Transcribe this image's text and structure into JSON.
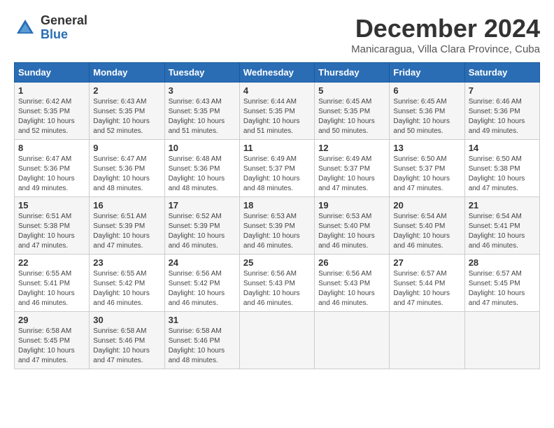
{
  "logo": {
    "general": "General",
    "blue": "Blue"
  },
  "title": {
    "month": "December 2024",
    "location": "Manicaragua, Villa Clara Province, Cuba"
  },
  "headers": [
    "Sunday",
    "Monday",
    "Tuesday",
    "Wednesday",
    "Thursday",
    "Friday",
    "Saturday"
  ],
  "weeks": [
    [
      {
        "day": "1",
        "sunrise": "6:42 AM",
        "sunset": "5:35 PM",
        "daylight": "10 hours and 52 minutes."
      },
      {
        "day": "2",
        "sunrise": "6:43 AM",
        "sunset": "5:35 PM",
        "daylight": "10 hours and 52 minutes."
      },
      {
        "day": "3",
        "sunrise": "6:43 AM",
        "sunset": "5:35 PM",
        "daylight": "10 hours and 51 minutes."
      },
      {
        "day": "4",
        "sunrise": "6:44 AM",
        "sunset": "5:35 PM",
        "daylight": "10 hours and 51 minutes."
      },
      {
        "day": "5",
        "sunrise": "6:45 AM",
        "sunset": "5:35 PM",
        "daylight": "10 hours and 50 minutes."
      },
      {
        "day": "6",
        "sunrise": "6:45 AM",
        "sunset": "5:36 PM",
        "daylight": "10 hours and 50 minutes."
      },
      {
        "day": "7",
        "sunrise": "6:46 AM",
        "sunset": "5:36 PM",
        "daylight": "10 hours and 49 minutes."
      }
    ],
    [
      {
        "day": "8",
        "sunrise": "6:47 AM",
        "sunset": "5:36 PM",
        "daylight": "10 hours and 49 minutes."
      },
      {
        "day": "9",
        "sunrise": "6:47 AM",
        "sunset": "5:36 PM",
        "daylight": "10 hours and 48 minutes."
      },
      {
        "day": "10",
        "sunrise": "6:48 AM",
        "sunset": "5:36 PM",
        "daylight": "10 hours and 48 minutes."
      },
      {
        "day": "11",
        "sunrise": "6:49 AM",
        "sunset": "5:37 PM",
        "daylight": "10 hours and 48 minutes."
      },
      {
        "day": "12",
        "sunrise": "6:49 AM",
        "sunset": "5:37 PM",
        "daylight": "10 hours and 47 minutes."
      },
      {
        "day": "13",
        "sunrise": "6:50 AM",
        "sunset": "5:37 PM",
        "daylight": "10 hours and 47 minutes."
      },
      {
        "day": "14",
        "sunrise": "6:50 AM",
        "sunset": "5:38 PM",
        "daylight": "10 hours and 47 minutes."
      }
    ],
    [
      {
        "day": "15",
        "sunrise": "6:51 AM",
        "sunset": "5:38 PM",
        "daylight": "10 hours and 47 minutes."
      },
      {
        "day": "16",
        "sunrise": "6:51 AM",
        "sunset": "5:39 PM",
        "daylight": "10 hours and 47 minutes."
      },
      {
        "day": "17",
        "sunrise": "6:52 AM",
        "sunset": "5:39 PM",
        "daylight": "10 hours and 46 minutes."
      },
      {
        "day": "18",
        "sunrise": "6:53 AM",
        "sunset": "5:39 PM",
        "daylight": "10 hours and 46 minutes."
      },
      {
        "day": "19",
        "sunrise": "6:53 AM",
        "sunset": "5:40 PM",
        "daylight": "10 hours and 46 minutes."
      },
      {
        "day": "20",
        "sunrise": "6:54 AM",
        "sunset": "5:40 PM",
        "daylight": "10 hours and 46 minutes."
      },
      {
        "day": "21",
        "sunrise": "6:54 AM",
        "sunset": "5:41 PM",
        "daylight": "10 hours and 46 minutes."
      }
    ],
    [
      {
        "day": "22",
        "sunrise": "6:55 AM",
        "sunset": "5:41 PM",
        "daylight": "10 hours and 46 minutes."
      },
      {
        "day": "23",
        "sunrise": "6:55 AM",
        "sunset": "5:42 PM",
        "daylight": "10 hours and 46 minutes."
      },
      {
        "day": "24",
        "sunrise": "6:56 AM",
        "sunset": "5:42 PM",
        "daylight": "10 hours and 46 minutes."
      },
      {
        "day": "25",
        "sunrise": "6:56 AM",
        "sunset": "5:43 PM",
        "daylight": "10 hours and 46 minutes."
      },
      {
        "day": "26",
        "sunrise": "6:56 AM",
        "sunset": "5:43 PM",
        "daylight": "10 hours and 46 minutes."
      },
      {
        "day": "27",
        "sunrise": "6:57 AM",
        "sunset": "5:44 PM",
        "daylight": "10 hours and 47 minutes."
      },
      {
        "day": "28",
        "sunrise": "6:57 AM",
        "sunset": "5:45 PM",
        "daylight": "10 hours and 47 minutes."
      }
    ],
    [
      {
        "day": "29",
        "sunrise": "6:58 AM",
        "sunset": "5:45 PM",
        "daylight": "10 hours and 47 minutes."
      },
      {
        "day": "30",
        "sunrise": "6:58 AM",
        "sunset": "5:46 PM",
        "daylight": "10 hours and 47 minutes."
      },
      {
        "day": "31",
        "sunrise": "6:58 AM",
        "sunset": "5:46 PM",
        "daylight": "10 hours and 48 minutes."
      },
      null,
      null,
      null,
      null
    ]
  ]
}
